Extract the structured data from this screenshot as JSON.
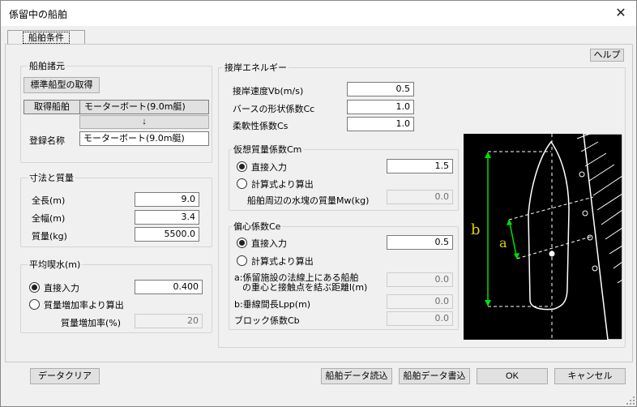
{
  "window": {
    "title": "係留中の船舶"
  },
  "tabs": [
    {
      "label": "船舶条件"
    }
  ],
  "help_label": "ヘルプ",
  "ship_specs": {
    "group_label": "船舶諸元",
    "get_standard_label": "標準船型の取得",
    "acquired_ship_label": "取得船舶",
    "acquired_ship_value": "モーターボート(9.0m艇)",
    "arrow": "↓",
    "registered_name_label": "登録名称",
    "registered_name_value": "モーターボート(9.0m艇)"
  },
  "dimensions": {
    "group_label": "寸法と質量",
    "length_label": "全長(m)",
    "length_value": "9.0",
    "width_label": "全幅(m)",
    "width_value": "3.4",
    "mass_label": "質量(kg)",
    "mass_value": "5500.0"
  },
  "draft": {
    "group_label": "平均喫水(m)",
    "direct_label": "直接入力",
    "direct_value": "0.400",
    "calc_label": "質量増加率より算出",
    "rate_label": "質量増加率(%)",
    "rate_value": "20"
  },
  "berthing": {
    "group_label": "接岸エネルギー",
    "speed_label": "接岸速度Vb(m/s)",
    "speed_value": "0.5",
    "shape_label": "バースの形状係数Cc",
    "shape_value": "1.0",
    "flex_label": "柔軟性係数Cs",
    "flex_value": "1.0"
  },
  "virtual_mass": {
    "group_label": "仮想質量係数Cm",
    "direct_label": "直接入力",
    "direct_value": "1.5",
    "calc_label": "計算式より算出",
    "water_label": "船舶周辺の水塊の質量Mw(kg)",
    "water_value": "0.0"
  },
  "eccentricity": {
    "group_label": "偏心係数Ce",
    "direct_label": "直接入力",
    "direct_value": "0.5",
    "calc_label": "計算式より算出",
    "a_label_line1": "a:係留施設の法線上にある船舶",
    "a_label_line2": "の重心と接触点を結ぶ距離l(m)",
    "a_value": "0.0",
    "b_label": "b:垂線間長Lpp(m)",
    "b_value": "0.0",
    "block_label": "ブロック係数Cb",
    "block_value": "0.0"
  },
  "diagram": {
    "a_label": "a",
    "b_label": "b",
    "accent_color": "#00e000",
    "label_color": "#e0d000"
  },
  "footer": {
    "clear_label": "データクリア",
    "read_label": "船舶データ読込",
    "write_label": "船舶データ書込",
    "ok_label": "OK",
    "cancel_label": "キャンセル"
  }
}
